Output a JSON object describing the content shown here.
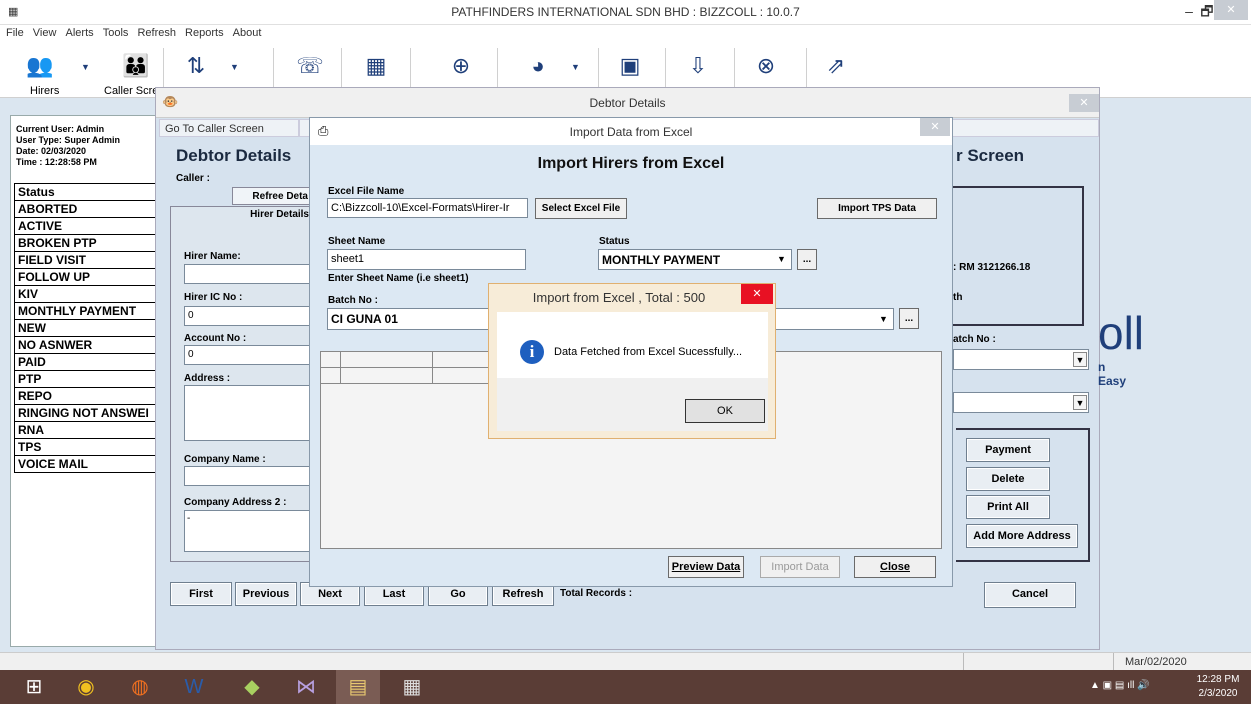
{
  "window": {
    "title": "PATHFINDERS INTERNATIONAL SDN BHD  :  BIZZCOLL  : 10.0.7",
    "min": "–",
    "max": "🗗",
    "close": "✕",
    "app_icon": "▦"
  },
  "menu": [
    "File",
    "View",
    "Alerts",
    "Tools",
    "Refresh",
    "Reports",
    "About"
  ],
  "toolbar": {
    "hirers_label": "Hirers",
    "caller_label": "Caller Scre",
    "icons": [
      "hirers-icon",
      "caller-icon",
      "sort-icon",
      "phone-icon",
      "calculator-icon",
      "search-icon",
      "pie-chart-icon",
      "card-icon",
      "download-icon",
      "close-circle-icon",
      "share-icon"
    ]
  },
  "left_panel": {
    "user": "Current User: Admin",
    "user_type": "User Type: Super Admin",
    "date": "Date: 02/03/2020",
    "time": "Time : 12:28:58 PM",
    "statuses": [
      "Status",
      "ABORTED",
      "ACTIVE",
      "BROKEN PTP",
      "FIELD VISIT",
      "FOLLOW UP",
      "KIV",
      "MONTHLY PAYMENT",
      "NEW",
      "NO ASNWER",
      "PAID",
      "PTP",
      "REPO",
      "RINGING NOT ANSWEI",
      "RNA",
      "TPS",
      "VOICE MAIL"
    ]
  },
  "debtor": {
    "window_title": "Debtor Details",
    "close": "✕",
    "goto_caller": "Go To Caller Screen",
    "heading": "Debtor Details",
    "caller_label": "Caller :",
    "tab_refree": "Refree Deta",
    "tab_hirer": "Hirer Details",
    "hirer_name_label": "Hirer Name:",
    "hirer_ic_label": "Hirer IC No :",
    "hirer_ic_value": "0",
    "account_label": "Account No :",
    "account_value": "0",
    "address_label": "Address :",
    "company_label": "Company Name :",
    "company_addr_label": "Company Address 2 :",
    "company_addr_value": "-",
    "caller_screen_heading": "r Screen",
    "amount": ": RM 3121266.18",
    "th_text": "th",
    "batch_label": "atch No :",
    "logo_text": "oll",
    "logo_sub": "n Easy",
    "nav": {
      "first": "First",
      "previous": "Previous",
      "next": "Next",
      "last": "Last",
      "go": "Go",
      "refresh": "Refresh",
      "total": "Total Records :"
    },
    "actions": {
      "payment": "Payment",
      "delete": "Delete",
      "print_all": "Print All",
      "add_address": "Add More Address",
      "cancel": "Cancel"
    }
  },
  "import": {
    "window_title": "Import Data from Excel",
    "close": "✕",
    "heading": "Import Hirers from Excel",
    "excel_label": "Excel File Name",
    "excel_value": "C:\\Bizzcoll-10\\Excel-Formats\\Hirer-Ir",
    "select_btn": "Select Excel File",
    "tps_btn": "Import TPS Data",
    "sheet_label": "Sheet Name",
    "sheet_value": "sheet1",
    "sheet_hint": "Enter Sheet Name (i.e  sheet1)",
    "status_label": "Status",
    "status_value": "MONTHLY PAYMENT",
    "batch_label": "Batch No :",
    "batch_value": "CI GUNA 01",
    "ellipsis": "...",
    "preview_btn": "Preview Data",
    "import_btn": "Import Data",
    "close_btn": "Close"
  },
  "message": {
    "title": "Import from Excel , Total : 500",
    "close": "✕",
    "text": "Data Fetched from Excel Sucessfully...",
    "ok": "OK"
  },
  "status_strip": {
    "date": "Mar/02/2020"
  },
  "taskbar": {
    "time": "12:28 PM",
    "date": "2/3/2020",
    "tray": "▲  ▣  ▤  ıll  🔊"
  },
  "colors": {
    "accent": "#1f3f7a",
    "title_close_red": "#e81123",
    "taskbar": "#5a3d36"
  }
}
